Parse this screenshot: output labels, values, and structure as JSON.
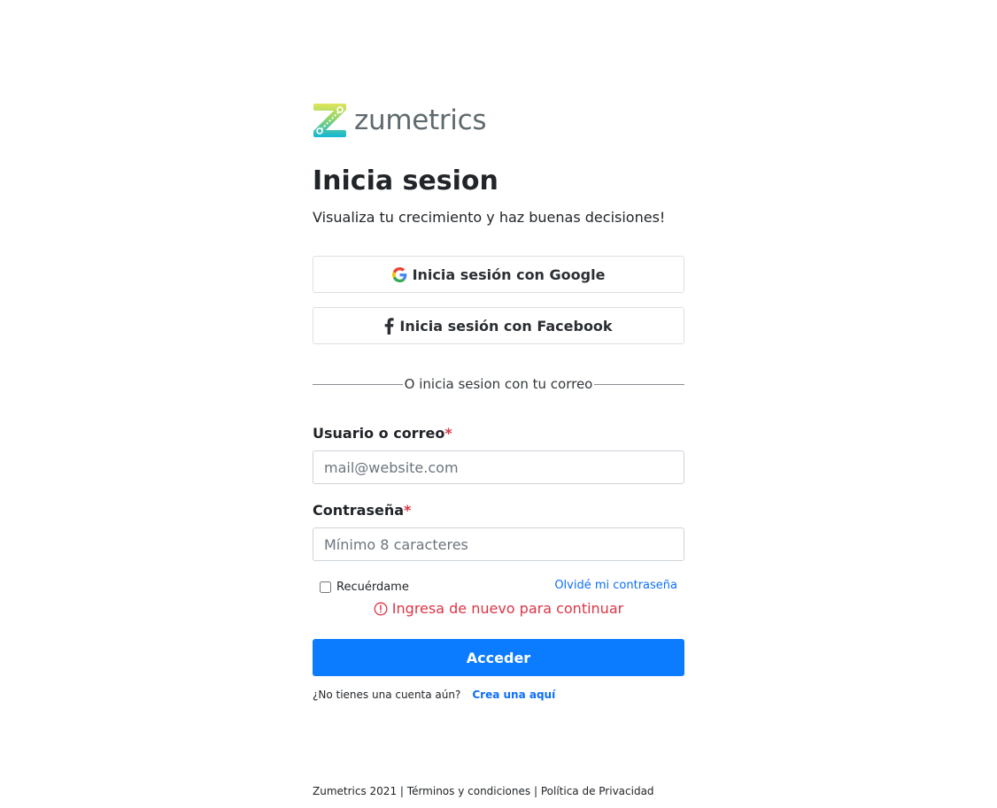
{
  "brand": {
    "name": "zumetrics",
    "gradient_top": "#d4e157",
    "gradient_bottom": "#00b8d4"
  },
  "heading": {
    "title": "Inicia sesion",
    "subtitle": "Visualiza tu crecimiento y haz buenas decisiones!"
  },
  "social": {
    "google_label": "Inicia sesión con Google",
    "facebook_label": "Inicia sesión con Facebook"
  },
  "divider_text": "O inicia sesion con tu correo",
  "form": {
    "user_label": "Usuario o correo",
    "user_placeholder": "mail@website.com",
    "password_label": "Contraseña",
    "password_placeholder": "Mínimo 8 caracteres",
    "required_mark": "*",
    "remember_label": "Recuérdame",
    "forgot_label": "Olvidé mi contraseña",
    "error_message": "Ingresa de nuevo para continuar",
    "submit_label": "Acceder"
  },
  "signup": {
    "prompt": "¿No tienes una cuenta aún?",
    "link": "Crea una aquí"
  },
  "footer": {
    "copyright": "Zumetrics 2021",
    "separator": "|",
    "terms": "Términos y condiciones",
    "privacy": "Política de Privacidad"
  },
  "colors": {
    "primary": "#0b7bff",
    "link": "#0d6efd",
    "error": "#dc3545"
  }
}
